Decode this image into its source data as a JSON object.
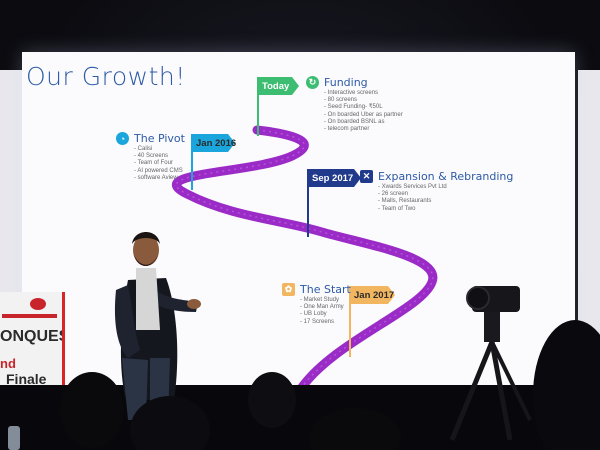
{
  "slide": {
    "title": "Our Growth!",
    "accent_color": "#2d5aa6",
    "road_color": "#9b2bc7",
    "flags": [
      {
        "label": "Today",
        "color": "#3dbd72",
        "icon": "flag-icon"
      },
      {
        "label": "Jan 2016",
        "color": "#1aa6dc",
        "icon": "flag-icon"
      },
      {
        "label": "Sep 2017",
        "color": "#223a8c",
        "icon": "flag-icon"
      },
      {
        "label": "Jan 2017",
        "color": "#f3b660",
        "icon": "flag-icon"
      }
    ],
    "milestones": [
      {
        "title": "Funding",
        "icon": "growth-icon",
        "icon_color": "#3dbd72",
        "items": [
          "Interactive screens",
          "80 screens",
          "Seed Funding- ₹50L",
          "On boarded Uber as partner",
          "On boarded BSNL as",
          "telecom partner"
        ]
      },
      {
        "title": "The Pivot",
        "icon": "chart-icon",
        "icon_color": "#1aa6dc",
        "items": [
          "Calisi",
          "40 Screens",
          "Team of Four",
          "AI powered CMS",
          "software Aview"
        ]
      },
      {
        "title": "Expansion & Rebranding",
        "icon": "tools-icon",
        "icon_color": "#223a8c",
        "items": [
          "Xwards Services Pvt Ltd",
          "26 screen",
          "Malls, Restaurants",
          "Team of Two"
        ]
      },
      {
        "title": "The Start",
        "icon": "gear-icon",
        "icon_color": "#f3b660",
        "items": [
          "Market Study",
          "One Man Army",
          "UB Loby",
          "17 Screens"
        ]
      }
    ]
  },
  "podium": {
    "text_line1": "ONQUEST",
    "text_line2": "nd",
    "text_line3": "Finale",
    "accent_color": "#c8242b"
  }
}
